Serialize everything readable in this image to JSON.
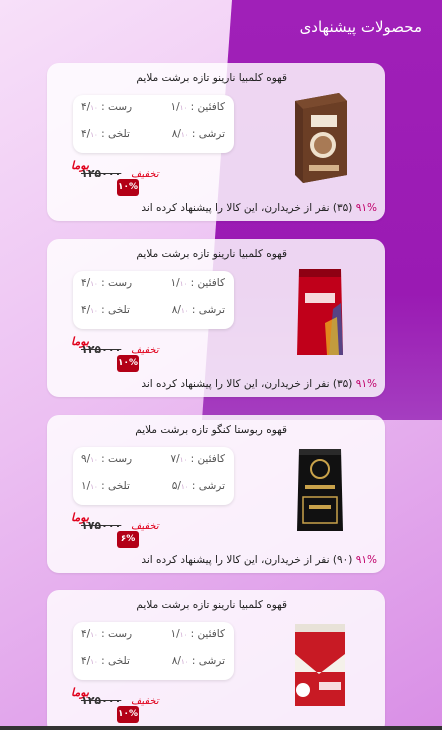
{
  "header": {
    "title": "محصولات پیشنهادی"
  },
  "labels": {
    "caffeine": "کافئین :",
    "acidity": "ترشی :",
    "body": "رست :",
    "bitter": "تلخی :",
    "scale_suffix": "۱۰",
    "discount_word": "تخفیف",
    "old_word": "بوما"
  },
  "products": [
    {
      "name": "قهوه کلمبیا نارینو تازه برشت ملایم",
      "caffeine": "۱/",
      "acidity": "۸/",
      "roast": "۴/",
      "bitter": "۴/",
      "price": "۱۲۵۰۰۰",
      "discount": "۱۰%",
      "recommend": "نفر از خریدارن، این کالا را پیشنهاد کرده اند",
      "rec_pct": "۹۱%",
      "rec_count": "(۳۵)",
      "image": "coffee-box-brown-icon"
    },
    {
      "name": "قهوه کلمبیا نارینو تازه برشت ملایم",
      "caffeine": "۱/",
      "acidity": "۸/",
      "roast": "۴/",
      "bitter": "۴/",
      "price": "۱۲۵۰۰۰",
      "discount": "۱۰%",
      "recommend": "نفر از خریدارن، این کالا را پیشنهاد کرده اند",
      "rec_pct": "۹۱%",
      "rec_count": "(۳۵)",
      "image": "coffee-bag-red-icon"
    },
    {
      "name": "قهوه ربوستا کنگو تازه برشت ملایم",
      "caffeine": "۷/",
      "acidity": "۵/",
      "roast": "۹/",
      "bitter": "۱/",
      "price": "۱۷۵۰۰۰",
      "discount": "۶%",
      "recommend": "نفر از خریدارن، این کالا را پیشنهاد کرده اند",
      "rec_pct": "۹۱%",
      "rec_count": "(۹۰)",
      "image": "coffee-bag-black-icon"
    },
    {
      "name": "قهوه کلمبیا نارینو تازه برشت ملایم",
      "caffeine": "۱/",
      "acidity": "۸/",
      "roast": "۴/",
      "bitter": "۴/",
      "price": "۱۲۵۰۰۰",
      "discount": "۱۰%",
      "image": "coffee-pack-red-white-icon"
    }
  ],
  "colors": {
    "accent": "#a020b8",
    "badge": "#b30017",
    "discount": "#e0001b"
  }
}
